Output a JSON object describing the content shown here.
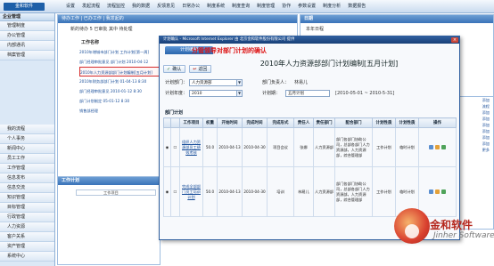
{
  "app": {
    "logo_text": "金和软件"
  },
  "topnav": [
    "设置",
    "发起流程",
    "流程监控",
    "我的数据",
    "反馈意见",
    "日常办公",
    "制度系统",
    "制度查询",
    "制度管理",
    "协作",
    "参数设置",
    "制度分析",
    "数据报告"
  ],
  "sidebar": {
    "header": "企业管理",
    "items": [
      "管理制度",
      "办公管理",
      "内部通讯",
      "档案管理",
      "我的流程",
      "个人事务",
      "新闻中心",
      "员工工作",
      "工作管理",
      "信息发布",
      "信息交流",
      "知识管理",
      "目标管理",
      "行政管理",
      "人力资源",
      "客户关系",
      "资产管理",
      "系统中心"
    ]
  },
  "workpanel": {
    "tabs": "待办工作 | 已办工作 | 我发起的",
    "sub": "新的待办 5  已审批   其中 待处理",
    "title": "工作名称",
    "items": [
      "2010年增城市部门计划 工作计划[第一周]",
      "部门经理审批意见 部门计划 2010-04-12",
      "2010年人力资源部部门计划编制[五月计划]",
      "2010年财务部部门计划 01-04-13 8:30",
      "部门经理审批意见 2010-01-12 8:30",
      "部门计划制定 05-01-12 8:30"
    ],
    "sub_item": "销售部经理"
  },
  "right_panel": {
    "label": "日期",
    "value": "本年日程"
  },
  "right_side": {
    "items": [
      "添加",
      "流程",
      "添加",
      "添加",
      "添加",
      "添加",
      "添加",
      "添加",
      "更多"
    ]
  },
  "bottom_panel": {
    "bar": "工作计划",
    "field": "工作项目"
  },
  "dialog": {
    "window_title": "计划确认 - Microsoft Internet Explorer 由 北京金和软件股份有限公司 提供",
    "tab": "计划编制",
    "note": "分管领导对部门计划的确认",
    "toolbar": {
      "confirm": "确认",
      "back": "返回"
    },
    "form_title": "2010年人力资源部部门计划编制[五月计划]",
    "fields": {
      "plan_dept_label": "计划部门：",
      "plan_dept_value": "人力资源部",
      "leader_label": "部门负责人：",
      "leader_value": "林易儿",
      "plan_year_label": "计划年度：",
      "plan_year_value": "2010",
      "period_label": "计划期：",
      "period_value": "五月计划",
      "date_range": "[2010-05-01 ~ 2010-5-31]"
    },
    "section_title": "部门计划",
    "columns": [
      "",
      "",
      "工作项目",
      "权重",
      "开始时间",
      "完成时间",
      "完成形式",
      "责任人",
      "责任部门",
      "配合部门",
      "计划性质",
      "计划性质",
      "操作"
    ],
    "rows": [
      {
        "item": "组织人力资源部员工绩效考核",
        "weight": "50.0",
        "start": "2010-04-13",
        "end": "2010-04-30",
        "form": "项目会议",
        "owner": "张娜",
        "resp_dept": "人力资源部",
        "coop": "部门各部门协助公司，总部各部门人力资源部，人力资源部，综合管理部",
        "nature1": "工作计划",
        "nature2": "临时计划"
      },
      {
        "item": "完成全部部门员工培训计划",
        "weight": "50.0",
        "start": "2010-04-13",
        "end": "2010-04-30",
        "form": "培训",
        "owner": "林易儿",
        "resp_dept": "人力资源部",
        "coop": "部门各部门协助公司，总部各部门人力资源部，人力资源部，综合管理部",
        "nature1": "工作计划",
        "nature2": "临时计划"
      }
    ]
  },
  "brand": {
    "cn": "金和软件",
    "en": "Jinher Software"
  }
}
